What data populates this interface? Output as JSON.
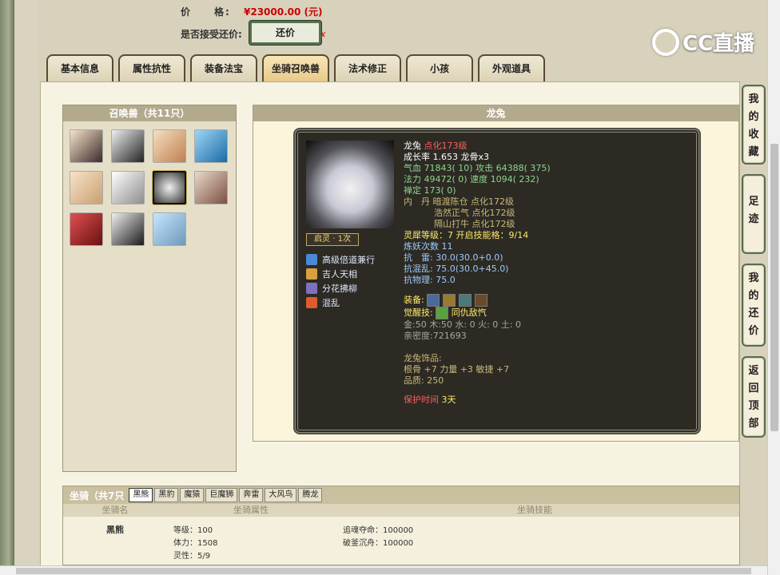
{
  "price": {
    "label": "价　　格:",
    "value": "¥23000.00 (元)"
  },
  "accept_counter": {
    "label": "是否接受还价:",
    "button": "还价",
    "x_mark": "✗"
  },
  "logo": {
    "text": "CC直播"
  },
  "tabs": [
    "基本信息",
    "属性抗性",
    "装备法宝",
    "坐骑召唤兽",
    "法术修正",
    "小孩",
    "外观道具"
  ],
  "active_tab": 3,
  "summon_list": {
    "title": "召唤兽（共11只）"
  },
  "detail": {
    "title": "龙兔",
    "awake": "启灵 · 1次",
    "skills": [
      {
        "name": "高级倍道兼行",
        "color": "#4a88d8"
      },
      {
        "name": "吉人天相",
        "color": "#d8a040"
      },
      {
        "name": "分花拂柳",
        "color": "#8070c0"
      },
      {
        "name": "混乱",
        "color": "#e05a30"
      }
    ],
    "name": "龙兔",
    "level": "点化173级",
    "growth": "成长率 1.653 龙骨x3",
    "hp_label": "气血",
    "hp": "71843( 10)",
    "atk_label": "攻击",
    "atk": "64388( 375)",
    "mp_label": "法力",
    "mp": "49472( 0)",
    "spd_label": "速度",
    "spd": "1094( 232)",
    "def_label": "禅定",
    "def": "173( 0)",
    "inner_label": "内　丹",
    "inner": [
      "暗渡陈仓 点化172级",
      "浩然正气 点化172级",
      "隔山打牛 点化172级"
    ],
    "soul": "灵犀等级：7 开启技能格：9/14",
    "refine": "炼妖次数 11",
    "res1": "抗　雷: 30.0(30.0+0.0)",
    "res2": "抗混乱: 75.0(30.0+45.0)",
    "res3": "抗物理: 75.0",
    "equip_label": "装备:",
    "awaken_label": "觉醒技:",
    "awaken_skill": "同仇敌忾",
    "elements": "金:50 木:50 水: 0 火: 0 土: 0",
    "intimacy": "亲密度:721693",
    "ornament_title": "龙兔饰品:",
    "ornament_stats": "根骨 +7 力量 +3 敏捷 +7",
    "quality": "品质:  250",
    "protect_label": "保护时间",
    "protect_value": "3天"
  },
  "mount": {
    "title": "坐骑（共7只",
    "tabs": [
      "黑熊",
      "黑豹",
      "魔猿",
      "巨魔狮",
      "奔雷",
      "大风鸟",
      "腾龙"
    ],
    "active_tab": 0,
    "headers": [
      "坐骑名",
      "坐骑属性",
      "坐骑技能"
    ],
    "row": {
      "name": "黑熊",
      "level": "等级：100",
      "stamina": "体力：1508",
      "spirit": "灵性：5/9",
      "skill1": "追魂夺命：100000",
      "skill2": "破釜沉舟：100000"
    }
  },
  "side_buttons": [
    "我的收藏",
    "足迹",
    "我的还价",
    "返回顶部"
  ]
}
